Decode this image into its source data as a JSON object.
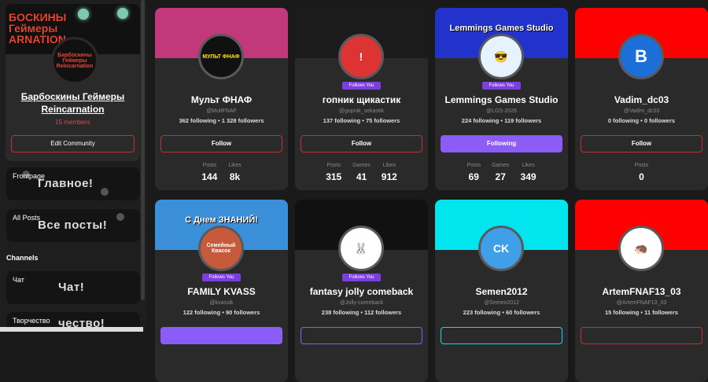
{
  "community": {
    "banner_text": "БОСКИНЫ\nГеймеры\nARNATION",
    "avatar_text": "Барбоскины Геймеры Reincarnation",
    "title": "Барбоскины Геймеры Reincarnation",
    "members": "15 members",
    "edit_label": "Edit Community"
  },
  "nav": {
    "frontpage_label": "Frontpage",
    "frontpage_art": "Главное!",
    "allposts_label": "All Posts",
    "allposts_art": "Все посты!",
    "channels_heading": "Channels",
    "chat_label": "Чат",
    "chat_art": "Чат!",
    "creative_label": "Творчество",
    "creative_art": "чество!"
  },
  "users": [
    {
      "name": "Мульт ФНАФ",
      "handle": "@MultFNAF",
      "following": "362 following",
      "followers": "1 328 followers",
      "button": "Follow",
      "follows_you": "",
      "stats": [
        {
          "label": "Posts",
          "value": "144"
        },
        {
          "label": "Likes",
          "value": "8k"
        }
      ],
      "banner_color": "#c2387a",
      "avatar_text": "МУЛЬТ ФНАФ"
    },
    {
      "name": "гопник щикастик",
      "handle": "@gopnik_sekastik",
      "following": "137 following",
      "followers": "75 followers",
      "button": "Follow",
      "follows_you": "Follows You",
      "stats": [
        {
          "label": "Posts",
          "value": "315"
        },
        {
          "label": "Games",
          "value": "41"
        },
        {
          "label": "Likes",
          "value": "912"
        }
      ],
      "banner_color": "#1b1b1b",
      "avatar_text": "!"
    },
    {
      "name": "Lemmings Games Studio",
      "handle": "@LGS-2026",
      "following": "224 following",
      "followers": "119 followers",
      "button": "Following",
      "follows_you": "Follows You",
      "stats": [
        {
          "label": "Posts",
          "value": "69"
        },
        {
          "label": "Games",
          "value": "27"
        },
        {
          "label": "Likes",
          "value": "349"
        }
      ],
      "banner_color": "#2233cc",
      "banner_text": "Lemmings Games Studio",
      "avatar_text": "😎"
    },
    {
      "name": "Vadim_dc03",
      "handle": "@Vadim_dc03",
      "following": "0 following",
      "followers": "0 followers",
      "button": "Follow",
      "follows_you": "",
      "stats": [
        {
          "label": "Posts",
          "value": "0"
        }
      ],
      "banner_color": "#ff0000",
      "avatar_text": "B"
    },
    {
      "name": "FAMILY KVASS",
      "handle": "@kvassik",
      "following": "122 following",
      "followers": "90 followers",
      "button": "",
      "follows_you": "Follows You",
      "banner_color": "#3a8fd8",
      "banner_text": "С Днем ЗНАНИЙ!",
      "avatar_text": "Семейный Квасок"
    },
    {
      "name": "fantasy jolly comeback",
      "handle": "@Jolly-comeback",
      "following": "238 following",
      "followers": "112 followers",
      "button": "",
      "follows_you": "Follows You",
      "banner_color": "#111111",
      "avatar_text": "🐰"
    },
    {
      "name": "Semen2012",
      "handle": "@Semen2012",
      "following": "223 following",
      "followers": "60 followers",
      "button": "",
      "follows_you": "",
      "banner_color": "#00e5ee",
      "avatar_text": "CK"
    },
    {
      "name": "ArtemFNAF13_03",
      "handle": "@ArtemFNAF13_03",
      "following": "15 following",
      "followers": "11 followers",
      "button": "",
      "follows_you": "",
      "banner_color": "#ff0000",
      "avatar_text": "🦔"
    }
  ],
  "colors": {
    "bg": "#1a1a1b",
    "card": "#2a2a2b",
    "accent_red": "#c53030",
    "accent_purple": "#8b5cf6"
  }
}
